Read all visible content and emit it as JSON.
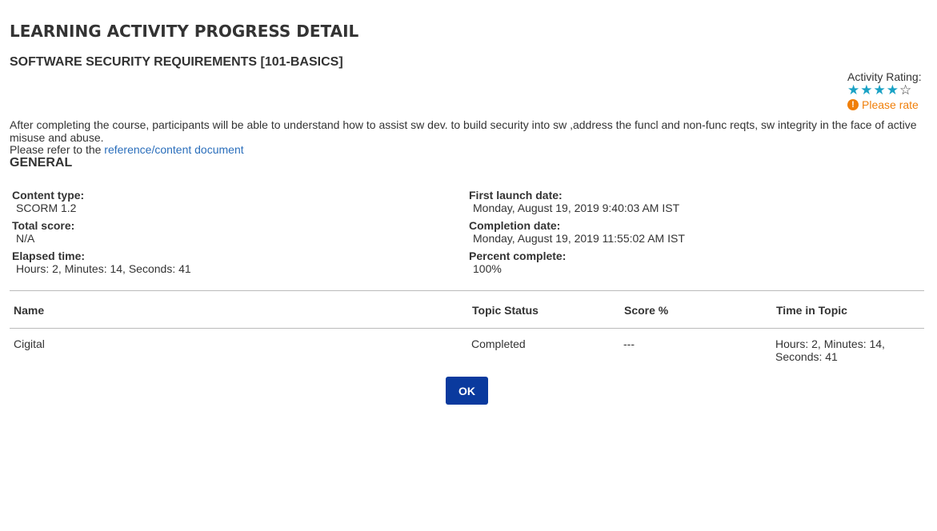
{
  "page_title": "LEARNING ACTIVITY PROGRESS DETAIL",
  "course_title": "SOFTWARE SECURITY REQUIREMENTS [101-BASICS]",
  "rating": {
    "label": "Activity Rating:",
    "value": 4,
    "max": 5,
    "please_rate": "Please rate",
    "filled_color": "#1aa2c5",
    "warning_color": "#f07f09",
    "warning_icon": "exclamation-circle-icon"
  },
  "description": "After completing the course, participants will be able to understand how to assist sw dev. to build security into sw ,address the funcl and non-func reqts, sw integrity in the face of active misuse and abuse.",
  "reference": {
    "prefix": "Please refer to the ",
    "link_text": "reference/content document"
  },
  "general": {
    "title": "GENERAL",
    "content_type": {
      "label": "Content type:",
      "value": "SCORM 1.2"
    },
    "total_score": {
      "label": "Total score:",
      "value": "N/A"
    },
    "elapsed_time": {
      "label": "Elapsed time:",
      "value": "Hours: 2, Minutes: 14, Seconds: 41"
    },
    "first_launch": {
      "label": "First launch date:",
      "value": "Monday, August 19, 2019 9:40:03 AM IST"
    },
    "completion_date": {
      "label": "Completion date:",
      "value": "Monday, August 19, 2019 11:55:02 AM IST"
    },
    "percent_complete": {
      "label": "Percent complete:",
      "value": "100%"
    }
  },
  "table": {
    "headers": {
      "name": "Name",
      "status": "Topic Status",
      "score": "Score %",
      "time": "Time in Topic"
    },
    "rows": [
      {
        "name": "Cigital",
        "status": "Completed",
        "score": "---",
        "time": "Hours: 2, Minutes: 14, Seconds: 41"
      }
    ]
  },
  "ok_label": "OK",
  "accent_color": "#0a3a9e"
}
